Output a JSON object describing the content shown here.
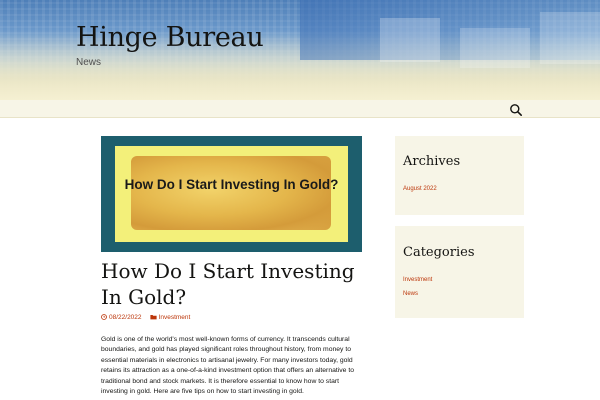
{
  "header": {
    "site_title": "Hinge Bureau",
    "site_description": "News"
  },
  "navbar": {
    "search_icon": "search-icon"
  },
  "post": {
    "featured_image_text": "How Do I Start Investing In Gold?",
    "title": "How Do I Start Investing In Gold?",
    "date": "08/22/2022",
    "category": "Investment",
    "date_icon": "clock-icon",
    "category_icon": "folder-icon",
    "body": "Gold is one of the world's most well-known forms of currency. It transcends cultural boundaries, and gold has played significant roles throughout history, from money to essential materials in electronics to artisanal jewelry. For many investors today, gold retains its attraction as a one-of-a-kind investment option that offers an alternative to traditional bond and stock markets. It is therefore essential to know how to start investing in gold. Here are five tips on how to start investing in gold."
  },
  "sidebar": {
    "archives": {
      "title": "Archives",
      "items": [
        "August 2022"
      ]
    },
    "categories": {
      "title": "Categories",
      "items": [
        "Investment",
        "News"
      ]
    }
  },
  "colors": {
    "link": "#bc360a",
    "widget_bg": "#f7f5e7",
    "thumb_bg": "#1d5e6d"
  }
}
